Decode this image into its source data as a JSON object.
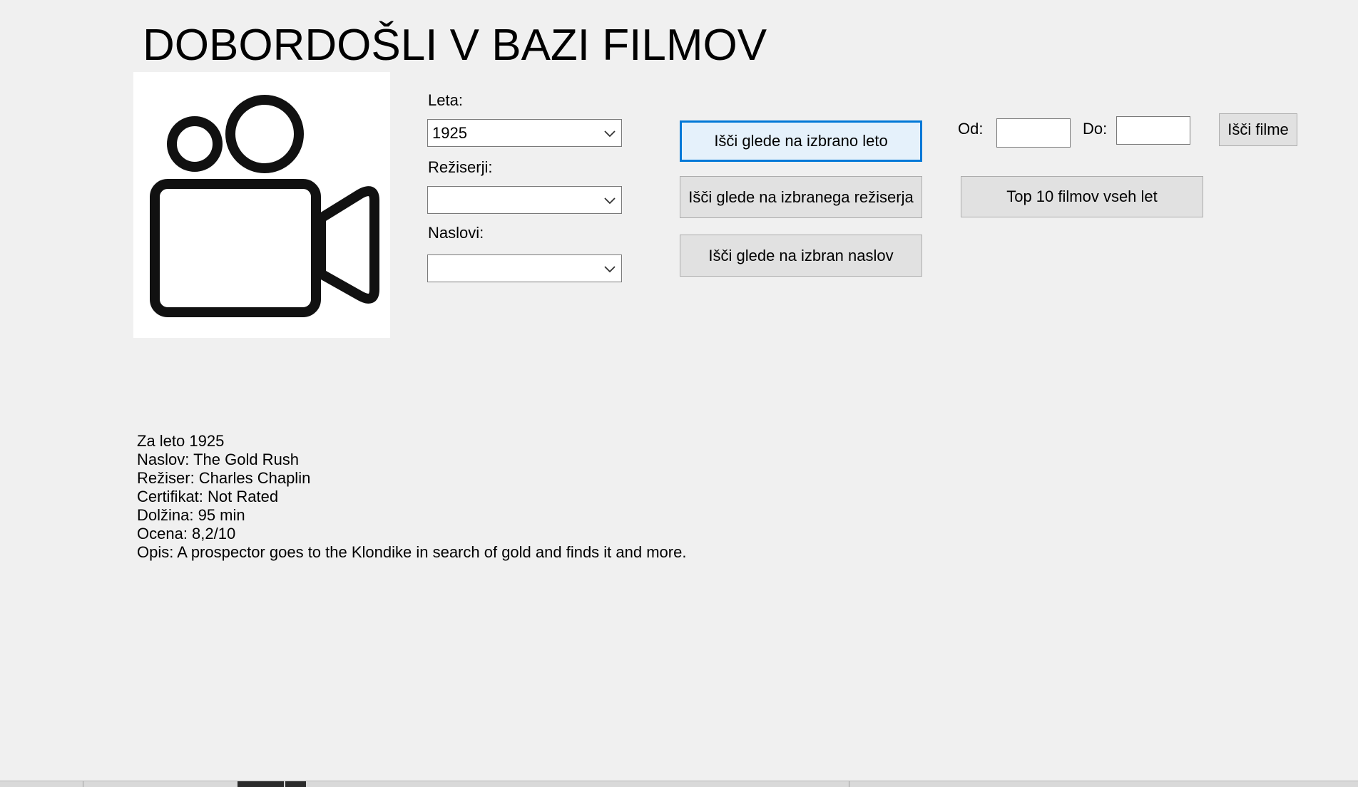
{
  "title": "DOBORDOŠLI V BAZI FILMOV",
  "icons": {
    "logo": "movie-camera-icon",
    "dropdown_arrow": "chevron-down-icon"
  },
  "filters": {
    "years": {
      "label": "Leta:",
      "selected": "1925"
    },
    "directors": {
      "label": "Režiserji:",
      "selected": ""
    },
    "titles": {
      "label": "Naslovi:",
      "selected": ""
    }
  },
  "buttons": {
    "search_year": "Išči glede na izbrano leto",
    "search_director": "Išči glede na izbranega režiserja",
    "search_title": "Išči glede na izbran naslov",
    "top10": "Top 10 filmov vseh let",
    "search_range": "Išči filme"
  },
  "range": {
    "from_label": "Od:",
    "from_value": "",
    "to_label": "Do:",
    "to_value": ""
  },
  "result": {
    "lines": [
      "Za leto 1925",
      "Naslov: The Gold Rush",
      "Režiser: Charles Chaplin",
      "Certifikat: Not Rated",
      "Dolžina: 95 min",
      "Ocena: 8,2/10",
      "Opis: A prospector goes to the Klondike in search of gold and finds it and more."
    ]
  }
}
